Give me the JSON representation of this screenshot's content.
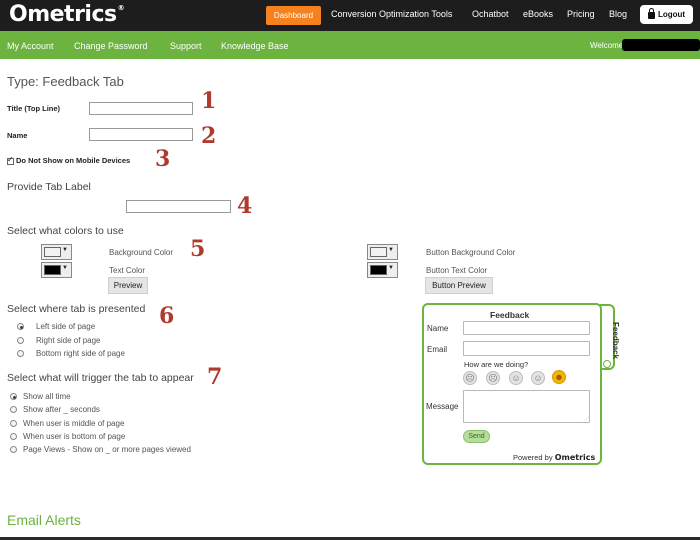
{
  "header": {
    "logo": "metrics",
    "logo_o": "O",
    "logo_reg": "®",
    "nav": [
      "Dashboard",
      "Conversion Optimization Tools",
      "Ochatbot",
      "eBooks",
      "Pricing",
      "Blog"
    ],
    "logout": "Logout"
  },
  "subnav": {
    "items": [
      "My Account",
      "Change Password",
      "Support",
      "Knowledge Base"
    ],
    "welcome": "Welcome"
  },
  "form": {
    "title": "Type: Feedback Tab",
    "title_label": "Title (Top Line)",
    "title_value": "",
    "name_label": "Name",
    "name_value": "",
    "mobile_label": "Do Not Show on Mobile Devices",
    "mobile_checked": true,
    "tab_label_heading": "Provide Tab Label",
    "tab_label_value": "",
    "colors_heading": "Select what colors to use",
    "bg_color_label": "Background Color",
    "text_color_label": "Text Color",
    "preview_label": "Preview",
    "btn_bg_color_label": "Button Background Color",
    "btn_text_color_label": "Button Text Color",
    "btn_preview_label": "Button Preview",
    "colors": {
      "background": "#f2f2f2",
      "text": "#000000",
      "button_background": "#f2f2f2",
      "button_text": "#000000",
      "accent": "#6cb33f",
      "brand_orange": "#f5821f",
      "annotation": "#b03a2e"
    },
    "position_heading": "Select where tab is presented",
    "positions": [
      "Left side of page",
      "Right side of page",
      "Bottom right side of page"
    ],
    "position_selected": 0,
    "trigger_heading": "Select what will trigger the tab to appear",
    "triggers": [
      "Show all time",
      "Show after _ seconds",
      "When user is middle of page",
      "When user is bottom of page",
      "Page Views - Show on _ or more pages viewed"
    ],
    "trigger_selected": 0
  },
  "annotations": [
    "1",
    "2",
    "3",
    "4",
    "5",
    "6",
    "7"
  ],
  "widget": {
    "title": "Feedback",
    "tab_text": "Feedback",
    "name_label": "Name",
    "email_label": "Email",
    "rating_prompt": "How are we doing?",
    "faces": [
      "very-sad-face-icon",
      "sad-face-icon",
      "neutral-face-icon",
      "smile-face-icon",
      "happy-face-icon"
    ],
    "message_label": "Message",
    "send_label": "Send",
    "powered_by": "Powered by",
    "powered_brand": "metrics",
    "powered_brand_o": "O"
  },
  "footer_section": {
    "email_alerts": "Email Alerts"
  }
}
